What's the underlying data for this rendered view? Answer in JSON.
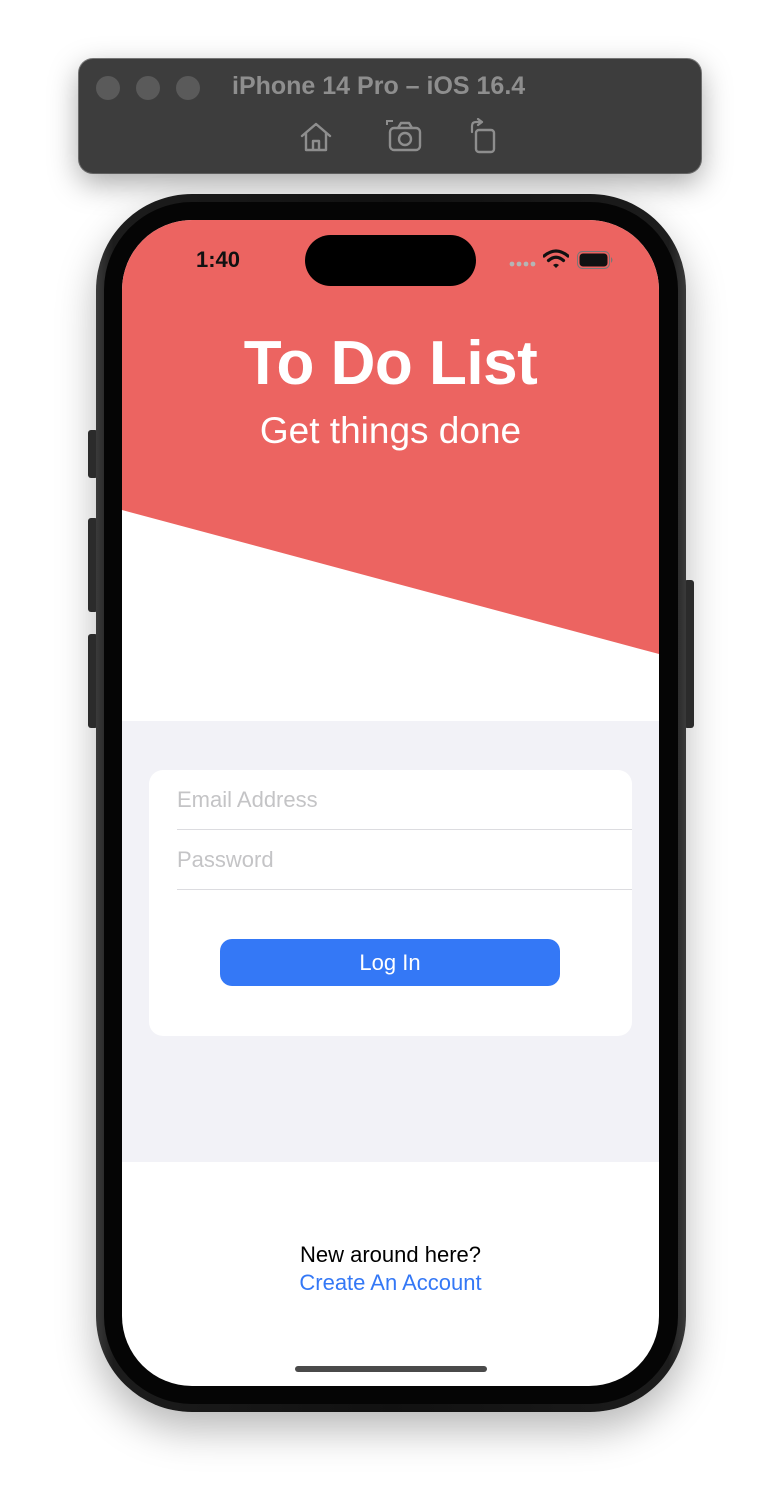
{
  "simulator": {
    "title": "iPhone 14 Pro – iOS 16.4",
    "toolbar_icons": [
      "home-icon",
      "screenshot-camera-icon",
      "rotate-icon"
    ]
  },
  "status_bar": {
    "time": "1:40",
    "icons": [
      "cellular-dots-icon",
      "wifi-icon",
      "battery-icon"
    ]
  },
  "header": {
    "title": "To Do List",
    "subtitle": "Get things done",
    "background_color": "#ec6461"
  },
  "login_form": {
    "email_placeholder": "Email Address",
    "email_value": "",
    "password_placeholder": "Password",
    "password_value": "",
    "login_label": "Log In",
    "button_color": "#3478f6",
    "area_color": "#f2f2f7"
  },
  "footer": {
    "prompt": "New around here?",
    "link": "Create An Account"
  }
}
